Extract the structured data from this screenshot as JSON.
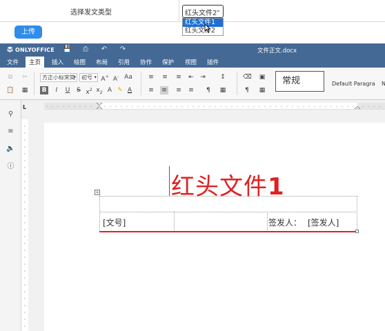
{
  "form": {
    "label": "选择发文类型",
    "selected_value": "红头文件2",
    "options": [
      "红头文件1",
      "红头文件2"
    ],
    "highlighted_option": "红头文件1",
    "upload_label": "上传"
  },
  "editor": {
    "brand": "ONLYOFFICE",
    "doc_title": "文件正文.docx",
    "menu": [
      "文件",
      "主页",
      "插入",
      "绘图",
      "布局",
      "引用",
      "协作",
      "保护",
      "视图",
      "插件"
    ],
    "active_menu": "主页",
    "font_name": "方正小标宋简",
    "font_size": "初号",
    "styles": [
      "常规",
      "Default Paragra",
      "N"
    ],
    "ruler_corner": "L"
  },
  "document": {
    "heading_text": "红头文件",
    "heading_num": "1",
    "doc_number_placeholder": "[文号]",
    "signer_label": "签发人：",
    "signer_placeholder": "[签发人]"
  },
  "colors": {
    "header_bar": "#446995",
    "heading_red": "#e02020",
    "upload_button": "#2f8cea",
    "dropdown_highlight": "#1e6fd0"
  }
}
